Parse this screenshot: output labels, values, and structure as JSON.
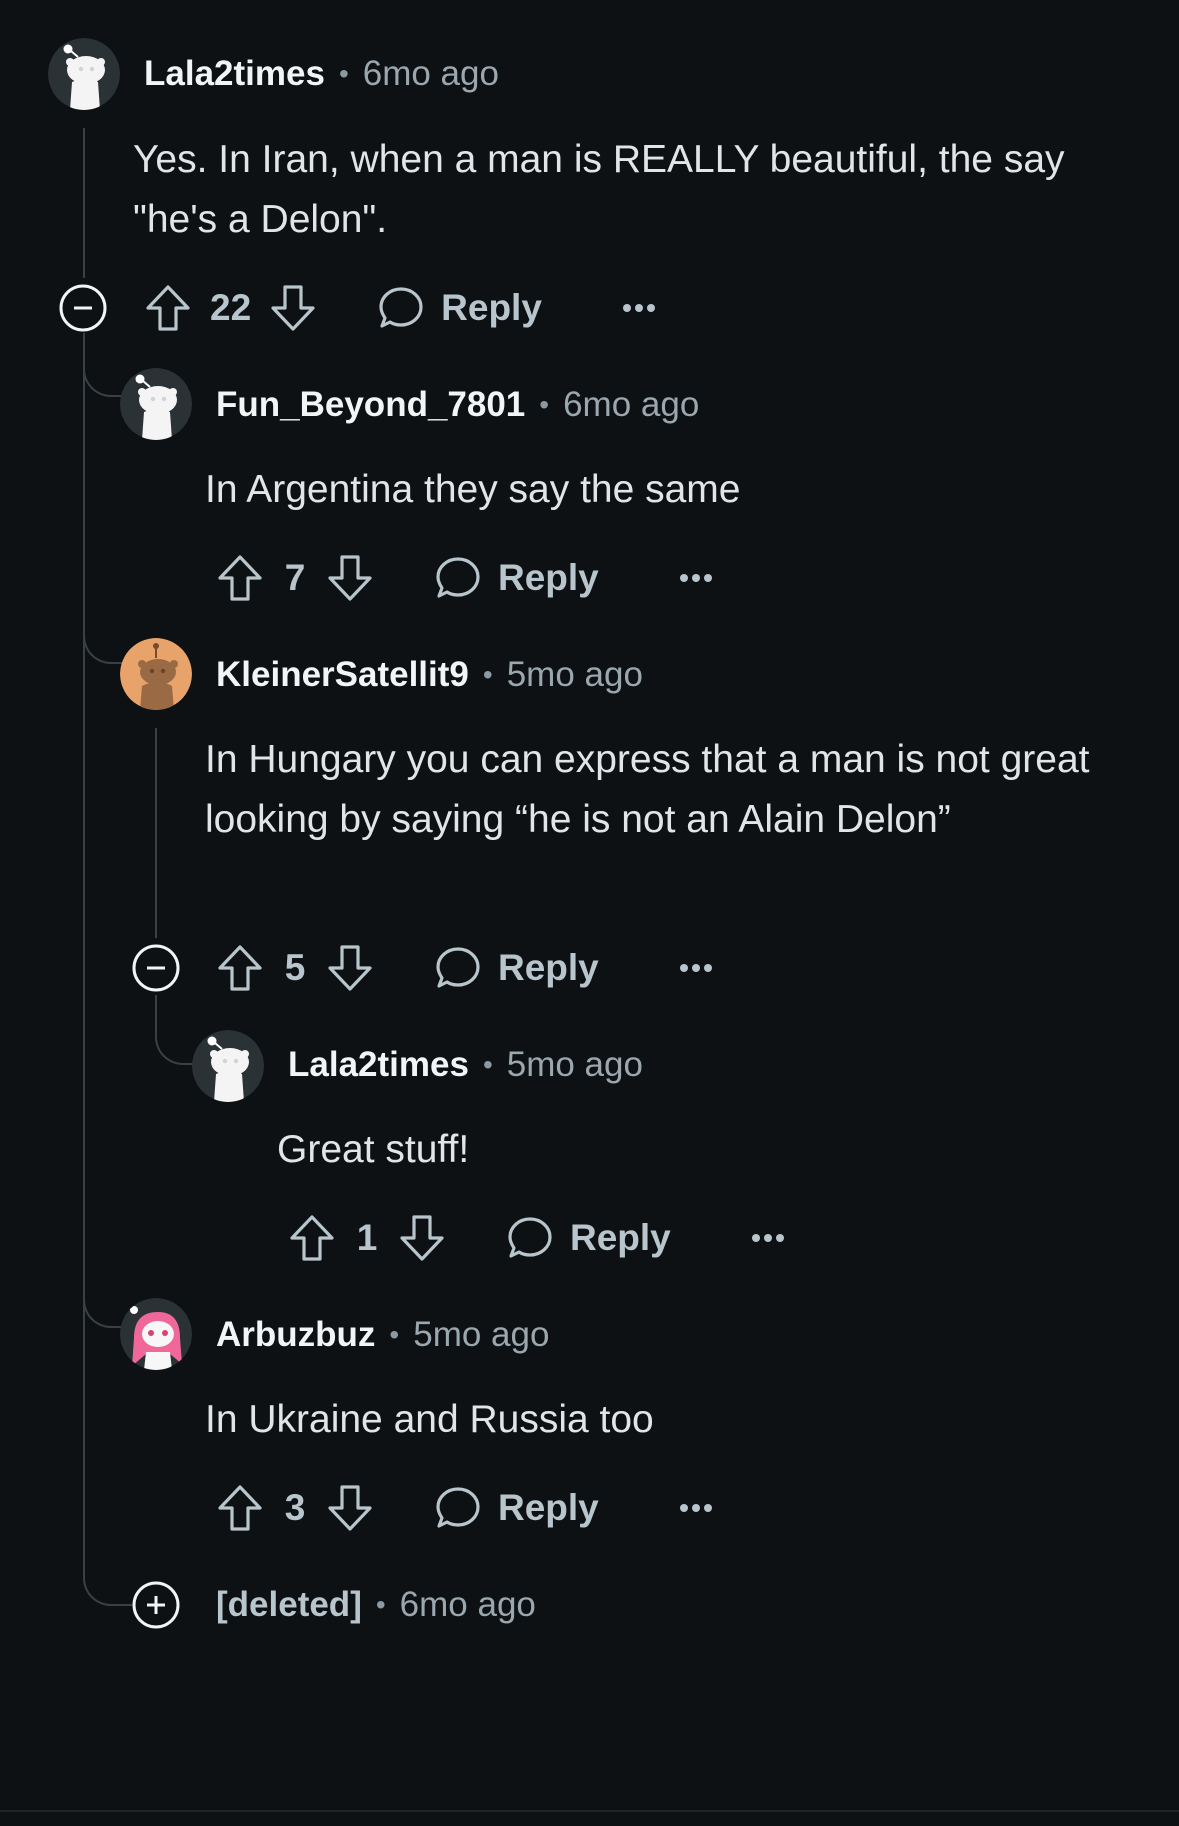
{
  "comments": [
    {
      "username": "Lala2times",
      "time": "6mo ago",
      "body": "Yes. In Iran, when a man is REALLY beautiful, the say \"he's a Delon\".",
      "votes": "22",
      "reply_label": "Reply",
      "avatar_icon": "snoo-default-avatar-icon"
    },
    {
      "username": "Fun_Beyond_7801",
      "time": "6mo ago",
      "body": "In Argentina they say the same",
      "votes": "7",
      "reply_label": "Reply",
      "avatar_icon": "snoo-default-avatar-icon"
    },
    {
      "username": "KleinerSatellit9",
      "time": "5mo ago",
      "body": "In Hungary you can express that a man is not great looking by saying “he is not an Alain Delon”",
      "votes": "5",
      "reply_label": "Reply",
      "avatar_icon": "snoo-orange-avatar-icon"
    },
    {
      "username": "Lala2times",
      "time": "5mo ago",
      "body": "Great stuff!",
      "votes": "1",
      "reply_label": "Reply",
      "avatar_icon": "snoo-default-avatar-icon"
    },
    {
      "username": "Arbuzbuz",
      "time": "5mo ago",
      "body": "In Ukraine and Russia too",
      "votes": "3",
      "reply_label": "Reply",
      "avatar_icon": "snoo-pink-hair-avatar-icon"
    },
    {
      "username": "[deleted]",
      "time": "6mo ago",
      "collapsed": true
    }
  ],
  "colors": {
    "background": "#0e1113",
    "thread_line": "#3a4043",
    "text": "#e2e5e7",
    "muted": "#9aa7ae"
  }
}
